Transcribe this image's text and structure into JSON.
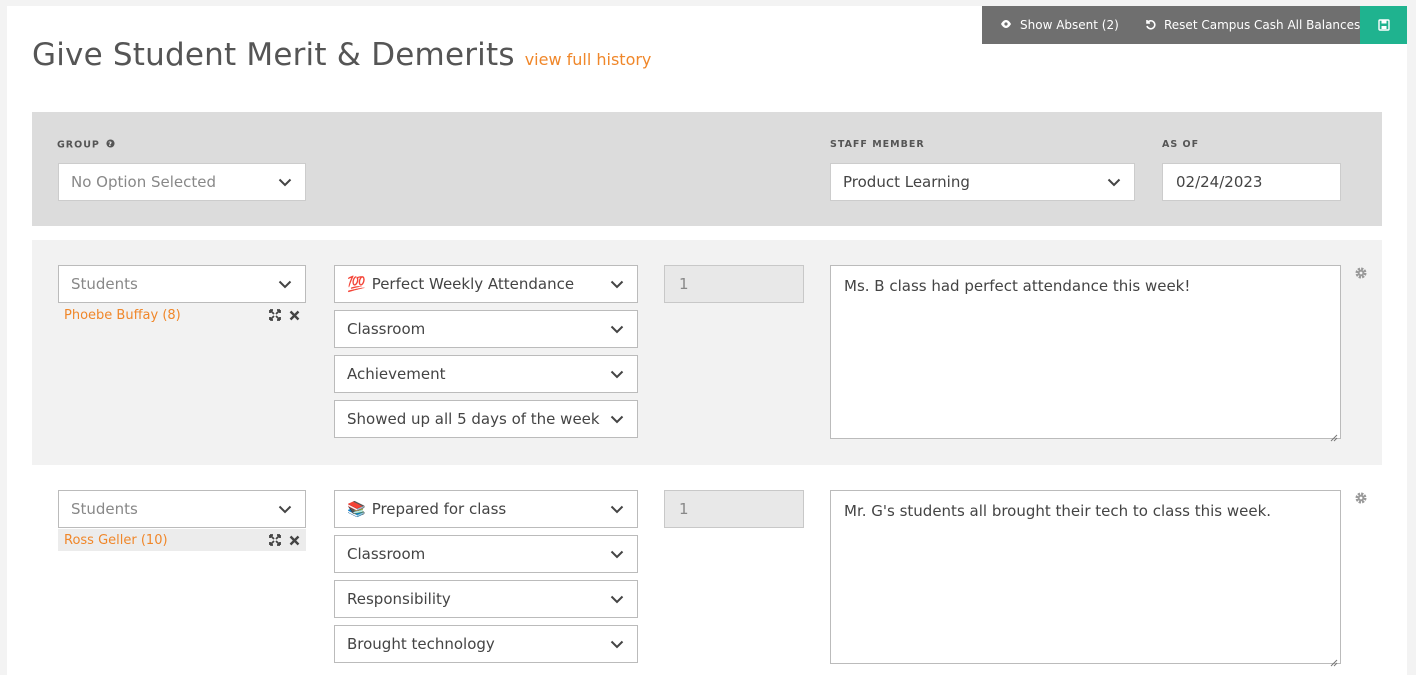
{
  "toolbar": {
    "show_absent_label": "Show Absent (2)",
    "reset_label": "Reset Campus Cash All Balances"
  },
  "header": {
    "title": "Give Student Merit & Demerits",
    "history_link": "view full history"
  },
  "filters": {
    "group_label": "GROUP",
    "group_value": "No Option Selected",
    "staff_label": "STAFF MEMBER",
    "staff_value": "Product Learning",
    "asof_label": "AS OF",
    "asof_value": "02/24/2023"
  },
  "entries": [
    {
      "students_placeholder": "Students",
      "student_name": "Phoebe Buffay (8)",
      "behavior_emoji": "💯",
      "behavior": "Perfect Weekly Attendance",
      "location": "Classroom",
      "category": "Achievement",
      "reason": "Showed up all 5 days of the week",
      "points": "1",
      "comment": "Ms. B class had perfect attendance this week!"
    },
    {
      "students_placeholder": "Students",
      "student_name": "Ross Geller (10)",
      "behavior_emoji": "📚",
      "behavior": "Prepared for class",
      "location": "Classroom",
      "category": "Responsibility",
      "reason": "Brought technology",
      "points": "1",
      "comment": "Mr. G's students all brought their tech to class this week."
    }
  ],
  "colors": {
    "accent_orange": "#f0872a",
    "toolbar_gray": "#6f6f6f",
    "save_green": "#1fb38f",
    "filter_bg": "#dcdcdc"
  }
}
